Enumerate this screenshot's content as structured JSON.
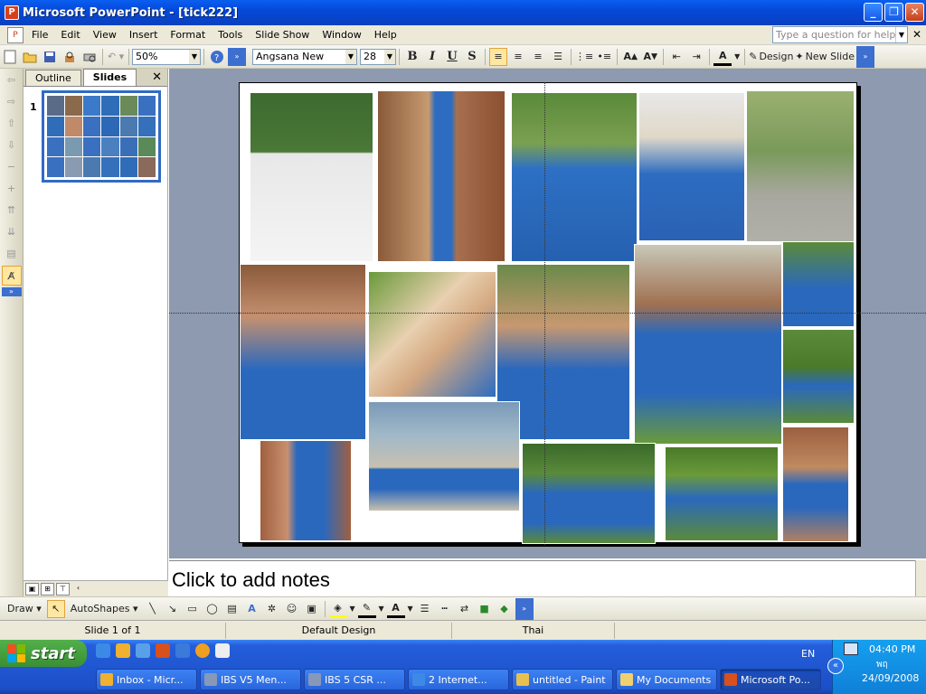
{
  "window": {
    "title": "Microsoft PowerPoint - [tick222]"
  },
  "menu": {
    "items": [
      "File",
      "Edit",
      "View",
      "Insert",
      "Format",
      "Tools",
      "Slide Show",
      "Window",
      "Help"
    ],
    "help_placeholder": "Type a question for help"
  },
  "toolbar": {
    "zoom": "50%",
    "font": "Angsana New",
    "font_size": "28",
    "bold": "B",
    "italic": "I",
    "underline": "U",
    "shadow": "S",
    "design": "Design",
    "new_slide": "New Slide"
  },
  "pane": {
    "tabs": [
      "Outline",
      "Slides"
    ],
    "active_tab": "Slides",
    "slide_number": "1"
  },
  "notes": {
    "placeholder": "Click to add notes"
  },
  "draw_toolbar": {
    "draw": "Draw",
    "autoshapes": "AutoShapes"
  },
  "status": {
    "slide": "Slide 1 of 1",
    "design": "Default Design",
    "language": "Thai"
  },
  "taskbar": {
    "start": "start",
    "lang": "EN",
    "time": "04:40 PM",
    "day": "พฤ",
    "date": "24/09/2008",
    "tasks": [
      "Inbox - Micr...",
      "IBS V5 Men...",
      "IBS 5 CSR ...",
      "2 Internet...",
      "untitled - Paint",
      "My Documents",
      "Microsoft Po..."
    ]
  },
  "colors": {
    "title_bar": "#0a5ff0",
    "selection": "#316ac5",
    "workspace": "#8d9ab0"
  },
  "slide_photos": [
    {
      "subject": "person-white-shirt-portrait"
    },
    {
      "subject": "person-standing-porch"
    },
    {
      "subject": "person-cap-sitting"
    },
    {
      "subject": "person-blue-shirt-smile"
    },
    {
      "subject": "person-beach-tripod"
    },
    {
      "subject": "person-closeup-sunglasses"
    },
    {
      "subject": "person-profile-closeup"
    },
    {
      "subject": "person-blue-shirt-garden"
    },
    {
      "subject": "person-camera-tripod-standing"
    },
    {
      "subject": "person-cap-seated"
    },
    {
      "subject": "person-kneeling-tripod"
    },
    {
      "subject": "person-doorway"
    },
    {
      "subject": "person-beach-camera-cap"
    },
    {
      "subject": "person-lying-grass"
    },
    {
      "subject": "person-crouching-camera"
    },
    {
      "subject": "person-standing-wall"
    }
  ]
}
